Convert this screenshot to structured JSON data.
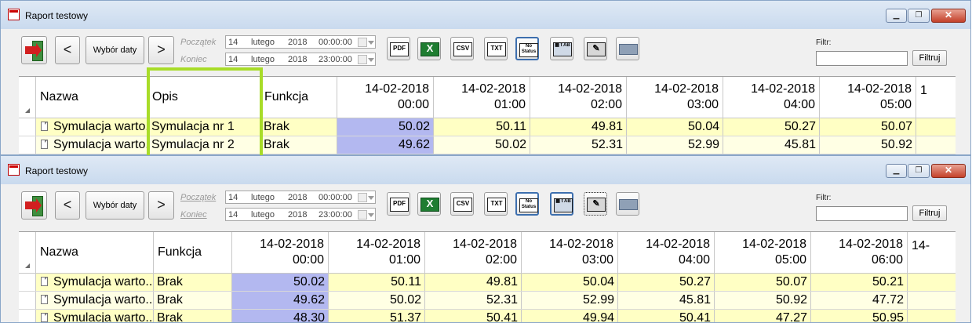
{
  "window": {
    "title": "Raport testowy",
    "min_glyph": "▁",
    "max_glyph": "❐",
    "close_glyph": "✕"
  },
  "toolbar": {
    "exit_icon": "exit-door-icon",
    "prev_glyph": "<",
    "next_glyph": ">",
    "date_button": "Wybór daty",
    "start_label": "Początek",
    "end_label": "Koniec",
    "start": {
      "day": "14",
      "month": "lutego",
      "year": "2018",
      "time": "00:00:00"
    },
    "end": {
      "day": "14",
      "month": "lutego",
      "year": "2018",
      "time": "23:00:00"
    },
    "export": {
      "pdf": "PDF",
      "excel": "X",
      "csv": "CSV",
      "txt": "TXT",
      "no_status": "No Status",
      "grid": "▦ t AB",
      "edit": "✎",
      "print": ""
    },
    "filter_label": "Filtr:",
    "filter_value": "",
    "filter_button": "Filtruj"
  },
  "top_table": {
    "columns": [
      "Nazwa",
      "Opis",
      "Funkcja"
    ],
    "date_headers": [
      {
        "d": "14-02-2018",
        "t": "00:00"
      },
      {
        "d": "14-02-2018",
        "t": "01:00"
      },
      {
        "d": "14-02-2018",
        "t": "02:00"
      },
      {
        "d": "14-02-2018",
        "t": "03:00"
      },
      {
        "d": "14-02-2018",
        "t": "04:00"
      },
      {
        "d": "14-02-2018",
        "t": "05:00"
      }
    ],
    "partial_header": "1",
    "rows": [
      {
        "name": "Symulacja warto...",
        "desc": "Symulacja nr 1",
        "func": "Brak",
        "v": [
          "50.02",
          "50.11",
          "49.81",
          "50.04",
          "50.27",
          "50.07"
        ]
      },
      {
        "name": "Symulacja warto...",
        "desc": "Symulacja nr 2",
        "func": "Brak",
        "v": [
          "49.62",
          "50.02",
          "52.31",
          "52.99",
          "45.81",
          "50.92"
        ]
      }
    ]
  },
  "bottom_table": {
    "columns": [
      "Nazwa",
      "Funkcja"
    ],
    "date_headers": [
      {
        "d": "14-02-2018",
        "t": "00:00"
      },
      {
        "d": "14-02-2018",
        "t": "01:00"
      },
      {
        "d": "14-02-2018",
        "t": "02:00"
      },
      {
        "d": "14-02-2018",
        "t": "03:00"
      },
      {
        "d": "14-02-2018",
        "t": "04:00"
      },
      {
        "d": "14-02-2018",
        "t": "05:00"
      },
      {
        "d": "14-02-2018",
        "t": "06:00"
      }
    ],
    "partial_header": "14-",
    "rows": [
      {
        "name": "Symulacja warto...",
        "func": "Brak",
        "v": [
          "50.02",
          "50.11",
          "49.81",
          "50.04",
          "50.27",
          "50.07",
          "50.21"
        ]
      },
      {
        "name": "Symulacja warto...",
        "func": "Brak",
        "v": [
          "49.62",
          "50.02",
          "52.31",
          "52.99",
          "45.81",
          "50.92",
          "47.72"
        ]
      },
      {
        "name": "Symulacja warto...",
        "func": "Brak",
        "v": [
          "48.30",
          "51.37",
          "50.41",
          "49.94",
          "50.41",
          "47.27",
          "50.95"
        ]
      }
    ]
  }
}
